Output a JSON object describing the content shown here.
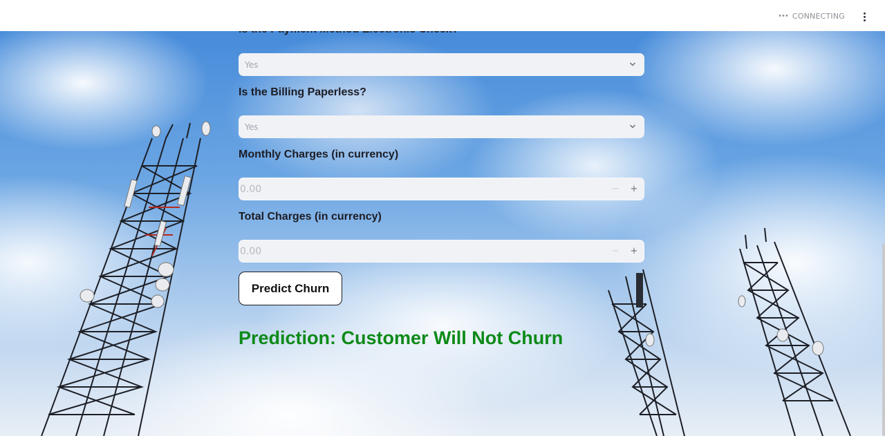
{
  "header": {
    "status_text": "CONNECTING",
    "status_icon": "ellipsis-icon",
    "menu_icon": "vertical-dots-icon"
  },
  "form": {
    "q_payment_electronic": {
      "label": "Is the Payment Method Electronic Check?",
      "value": "Yes"
    },
    "q_paperless": {
      "label": "Is the Billing Paperless?",
      "value": "Yes"
    },
    "monthly_charges": {
      "label": "Monthly Charges (in currency)",
      "placeholder": "0.00",
      "minus": "−",
      "plus": "+"
    },
    "total_charges": {
      "label": "Total Charges (in currency)",
      "placeholder": "0.00",
      "minus": "−",
      "plus": "+"
    },
    "predict_button": "Predict Churn",
    "result": "Prediction: Customer Will Not Churn"
  },
  "colors": {
    "result_green": "#0d8a18",
    "input_bg": "#f0f2f6"
  }
}
